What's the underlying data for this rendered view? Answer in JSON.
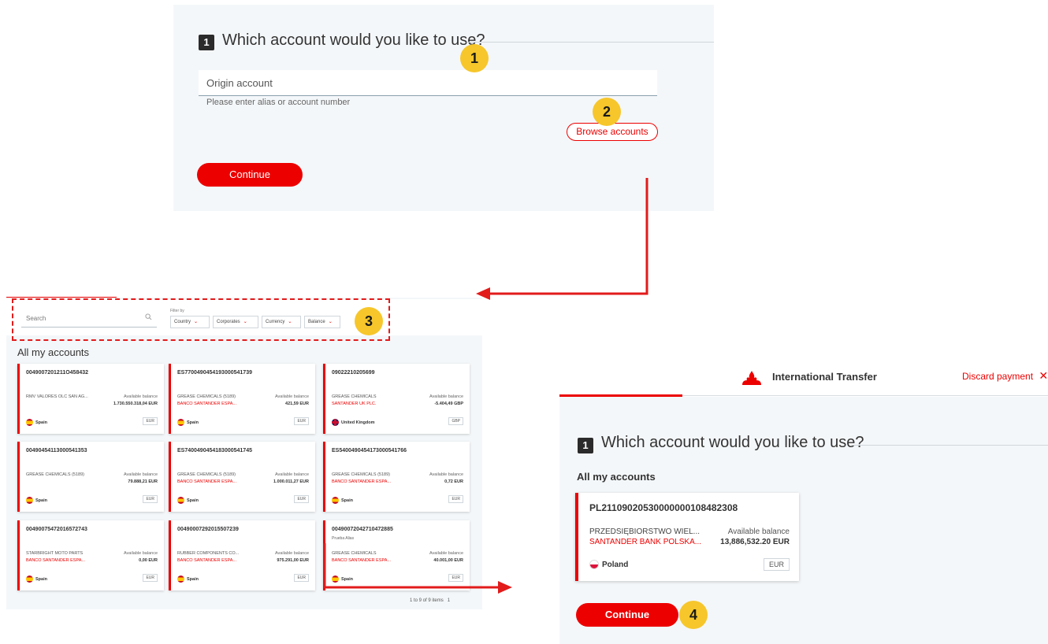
{
  "panel_a": {
    "step_number": "1",
    "step_title": "Which account would you like to use?",
    "origin_placeholder": "Origin account",
    "helper_text": "Please enter alias or account number",
    "browse_label": "Browse accounts",
    "continue_label": "Continue"
  },
  "badges": [
    "1",
    "2",
    "3",
    "4"
  ],
  "panel_b": {
    "search_placeholder": "Search",
    "filter_by_label": "Filter by",
    "filters": [
      "Country",
      "Corporates",
      "Currency",
      "Balance"
    ],
    "section_title": "All my accounts",
    "available_balance_label": "Available balance",
    "pager_text": "1 to 9 of 9 items",
    "pager_page": "1",
    "accounts": [
      {
        "number": "0049007201211O458432",
        "alias": "",
        "holder": "RMV VALORES OLC SAN AG...",
        "bank": "",
        "amount": "1.730.550.318,04 EUR",
        "country": "Spain",
        "flag": "es",
        "currency": "EUR"
      },
      {
        "number": "ES7700490454193000541739",
        "alias": "",
        "holder": "GREASE CHEMICALS (5189)",
        "bank": "BANCO SANTANDER ESPA...",
        "amount": "421,59 EUR",
        "country": "Spain",
        "flag": "es",
        "currency": "EUR"
      },
      {
        "number": "09022210205699",
        "alias": "",
        "holder": "GREASE CHEMICALS",
        "bank": "SANTANDER UK PLC.",
        "amount": "-5.404,49 GBP",
        "country": "United Kingdom",
        "flag": "uk",
        "currency": "GBP"
      },
      {
        "number": "00490454113000541353",
        "alias": "",
        "holder": "GREASE CHEMICALS (5189)",
        "bank": "",
        "amount": "79.888,21 EUR",
        "country": "Spain",
        "flag": "es",
        "currency": "EUR"
      },
      {
        "number": "ES7400490454183000541745",
        "alias": "",
        "holder": "GREASE CHEMICALS (5189)",
        "bank": "BANCO SANTANDER ESPA...",
        "amount": "1.000.011,27 EUR",
        "country": "Spain",
        "flag": "es",
        "currency": "EUR"
      },
      {
        "number": "ES5400490454173000541766",
        "alias": "",
        "holder": "GREASE CHEMICALS (5189)",
        "bank": "BANCO SANTANDER ESPA...",
        "amount": "0,72 EUR",
        "country": "Spain",
        "flag": "es",
        "currency": "EUR"
      },
      {
        "number": "00490075472016572743",
        "alias": "",
        "holder": "STARBRIGHT MOTO PARTS",
        "bank": "BANCO SANTANDER ESPA...",
        "amount": "0,00 EUR",
        "country": "Spain",
        "flag": "es",
        "currency": "EUR"
      },
      {
        "number": "00490007292015507239",
        "alias": "",
        "holder": "RUBBER COMPONENTS CO...",
        "bank": "BANCO SANTANDER ESPA...",
        "amount": "975.291,00 EUR",
        "country": "Spain",
        "flag": "es",
        "currency": "EUR"
      },
      {
        "number": "00490072042710472885",
        "alias": "Prueba Alias",
        "holder": "GREASE CHEMICALS",
        "bank": "BANCO SANTANDER ESPA...",
        "amount": "40.001,00 EUR",
        "country": "Spain",
        "flag": "es",
        "currency": "EUR"
      }
    ]
  },
  "panel_c": {
    "header_title": "International Transfer",
    "discard_label": "Discard payment",
    "step_number": "1",
    "step_title": "Which account would you like to use?",
    "section_title": "All my accounts",
    "account": {
      "number": "PL21109020530000000108482308",
      "holder": "PRZEDSIĘBIORSTWO WIEL...",
      "bank": "SANTANDER BANK POLSKA...",
      "balance_label": "Available balance",
      "amount": "13,886,532.20 EUR",
      "country": "Poland",
      "currency": "EUR"
    },
    "continue_label": "Continue"
  },
  "colors": {
    "brand_red": "#ec0000",
    "badge_yellow": "#f6c62b",
    "panel_bg": "#f4f7f9"
  }
}
